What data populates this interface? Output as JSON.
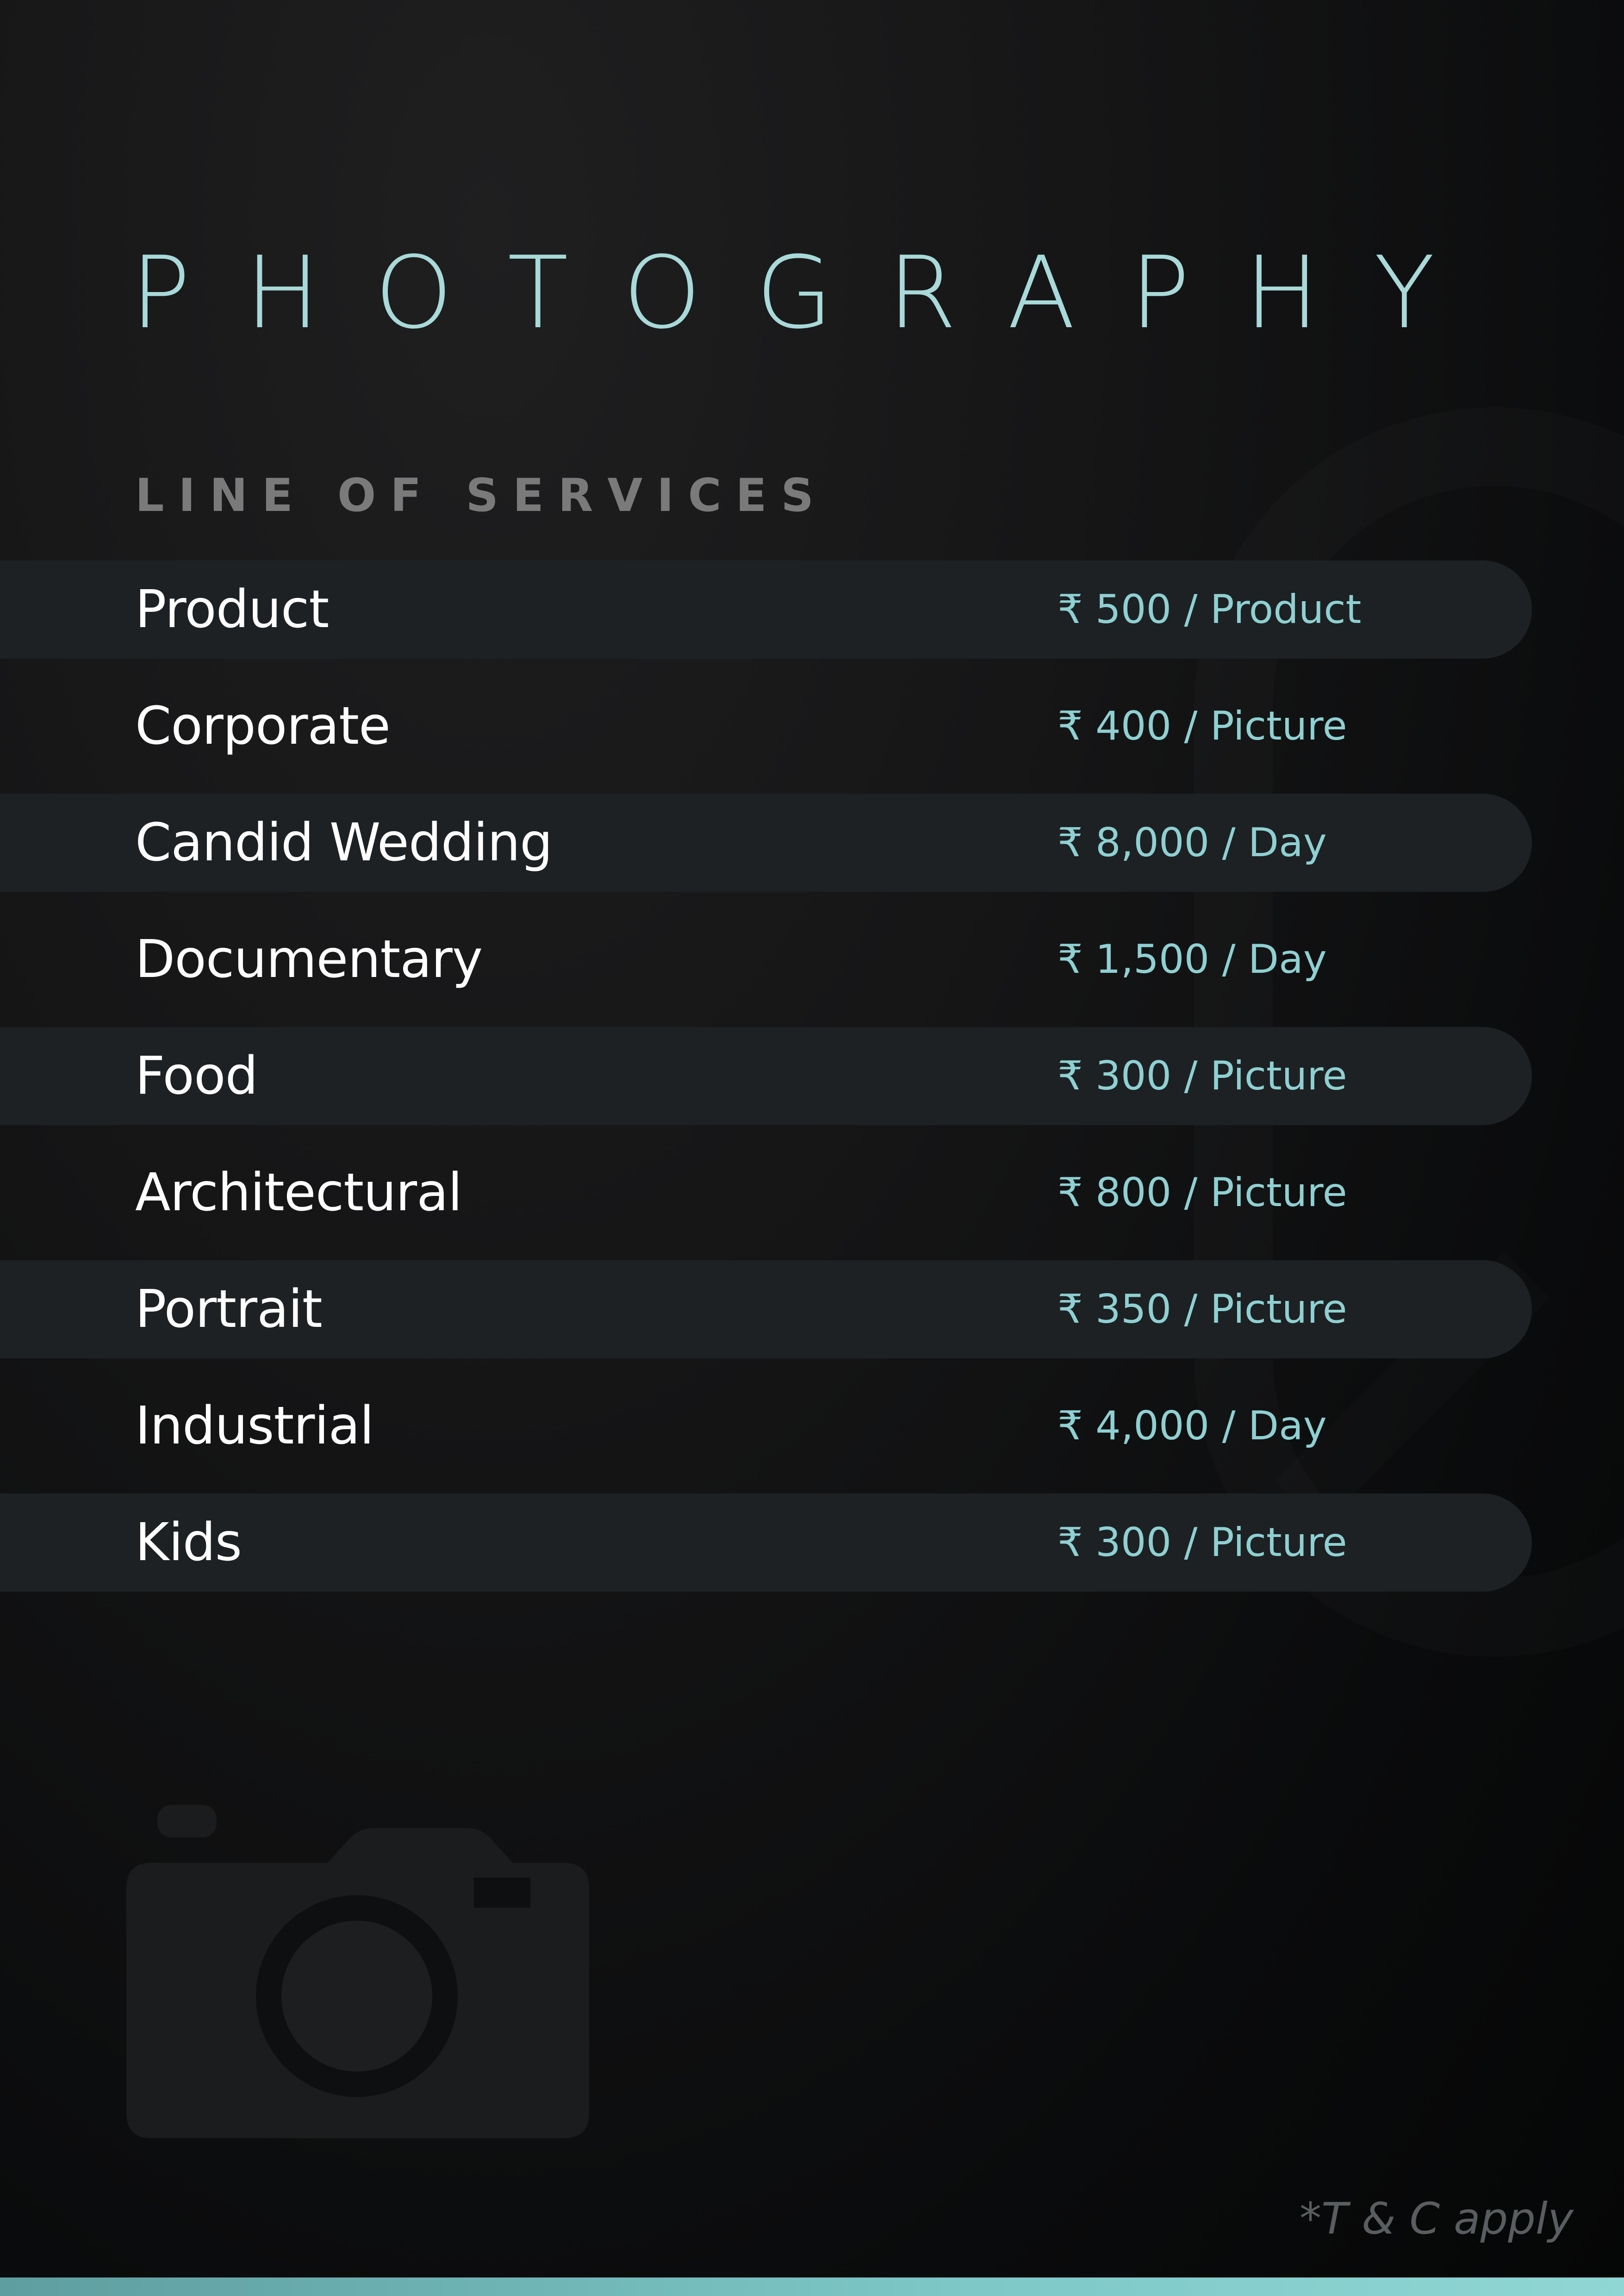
{
  "header": {
    "title": "PHOTOGRAPHY",
    "subtitle": "LINE OF SERVICES"
  },
  "services": [
    {
      "name": "Product",
      "price": "₹ 500 / Product"
    },
    {
      "name": "Corporate",
      "price": "₹ 400 / Picture"
    },
    {
      "name": "Candid Wedding",
      "price": "₹ 8,000 / Day"
    },
    {
      "name": "Documentary",
      "price": "₹ 1,500 / Day"
    },
    {
      "name": "Food",
      "price": "₹ 300 / Picture"
    },
    {
      "name": "Architectural",
      "price": "₹ 800 / Picture"
    },
    {
      "name": "Portrait",
      "price": "₹ 350 / Picture"
    },
    {
      "name": "Industrial",
      "price": "₹ 4,000 / Day"
    },
    {
      "name": "Kids",
      "price": "₹ 300 / Picture"
    }
  ],
  "footer": {
    "terms": "*T & C apply"
  },
  "colors": {
    "accent": "#8fd0d2",
    "title": "#a9d9d9",
    "band": "#1d2124",
    "background": "#0b0c0d"
  },
  "icons": {
    "background_graphic": "camera-icon"
  }
}
